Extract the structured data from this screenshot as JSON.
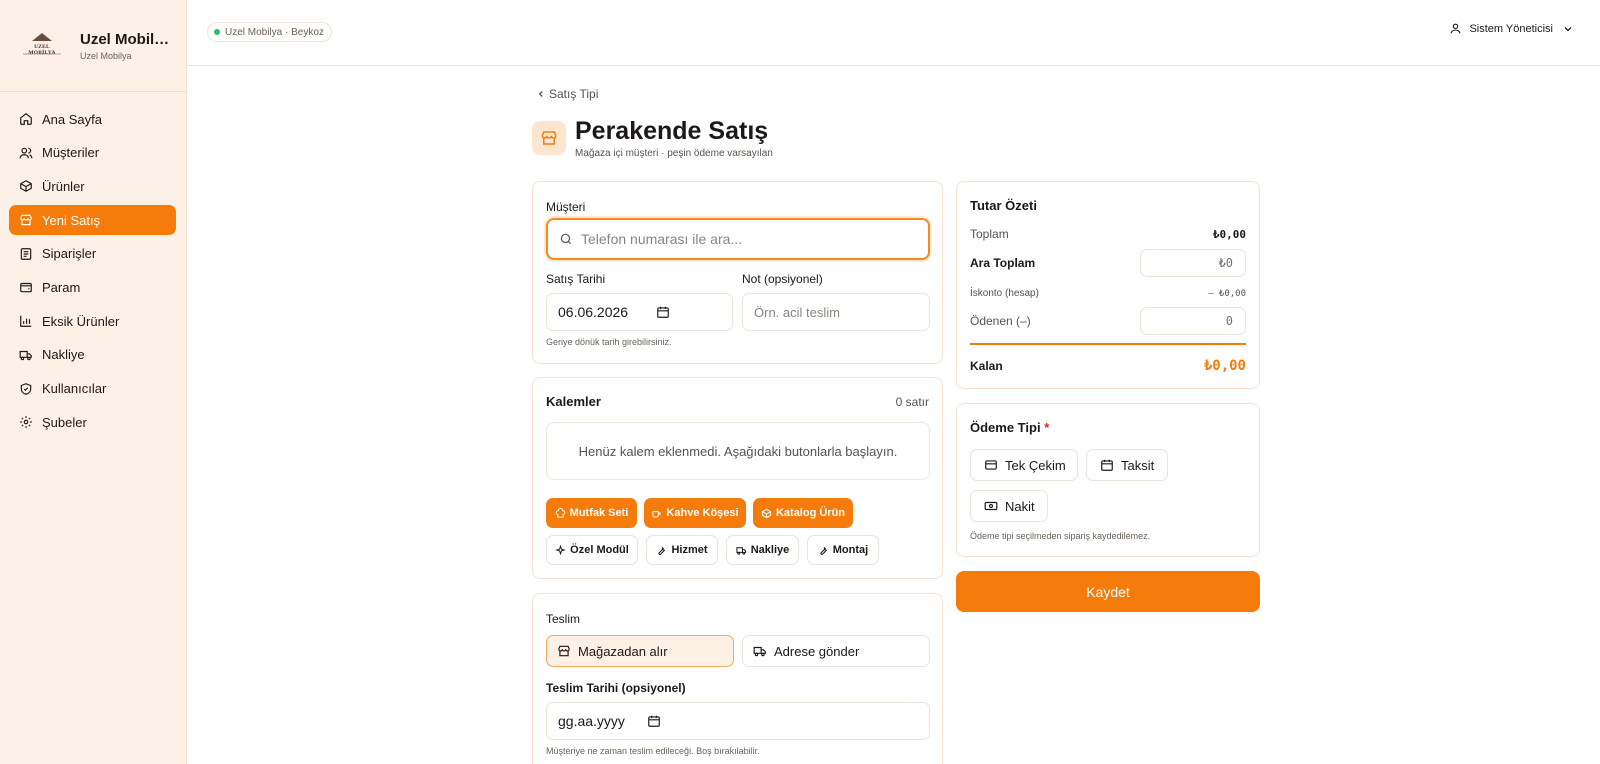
{
  "brand": {
    "title": "Uzel Mobilya",
    "subtitle": "Uzel Mobilya",
    "logo_text": "UZEL MOBİLYA",
    "logo_sub": "MOBİLYA & DEKORASYON"
  },
  "nav": [
    {
      "label": "Ana Sayfa",
      "icon": "home-icon"
    },
    {
      "label": "Müşteriler",
      "icon": "users-icon"
    },
    {
      "label": "Ürünler",
      "icon": "box-icon"
    },
    {
      "label": "Yeni Satış",
      "icon": "store-icon",
      "active": true
    },
    {
      "label": "Siparişler",
      "icon": "list-icon"
    },
    {
      "label": "Param",
      "icon": "wallet-icon"
    },
    {
      "label": "Eksik Ürünler",
      "icon": "bar-chart-icon"
    },
    {
      "label": "Nakliye",
      "icon": "truck-icon"
    },
    {
      "label": "Kullanıcılar",
      "icon": "shield-icon"
    },
    {
      "label": "Şubeler",
      "icon": "gear-icon"
    }
  ],
  "header": {
    "branch": "Uzel Mobilya · Beykoz",
    "user": "Sistem Yöneticisi"
  },
  "page": {
    "back": "Satış Tipi",
    "title": "Perakende Satış",
    "subtitle": "Mağaza içi müşteri · peşin ödeme varsayılan"
  },
  "customer": {
    "label": "Müşteri",
    "search_placeholder": "Telefon numarası ile ara...",
    "date_label": "Satış Tarihi",
    "date_value": "06.06.2026",
    "note_label": "Not (opsiyonel)",
    "note_placeholder": "Örn. acil teslim",
    "hint": "Geriye dönük tarih girebilirsiniz."
  },
  "items": {
    "title": "Kalemler",
    "count": "0 satır",
    "empty": "Henüz kalem eklenmedi. Aşağıdaki butonlarla başlayın.",
    "primary_buttons": [
      "Mutfak Seti",
      "Kahve Köşesi",
      "Katalog Ürün"
    ],
    "secondary_buttons": [
      "Özel Modül",
      "Hizmet",
      "Nakliye",
      "Montaj"
    ]
  },
  "delivery": {
    "title": "Teslim",
    "options": [
      "Mağazadan alır",
      "Adrese gönder"
    ],
    "selected": "Mağazadan alır",
    "date_label": "Teslim Tarihi (opsiyonel)",
    "date_placeholder": "gg.aa.yyyy",
    "hint": "Müşteriye ne zaman teslim edileceği. Boş bırakılabilir."
  },
  "summary": {
    "title": "Tutar Özeti",
    "total_label": "Toplam",
    "total_value": "₺0,00",
    "subtotal_label": "Ara Toplam",
    "subtotal_value": "₺0",
    "discount_label": "İskonto (hesap)",
    "discount_value": "– ₺0,00",
    "paid_label": "Ödenen (–)",
    "paid_value": "0",
    "remaining_label": "Kalan",
    "remaining_value": "₺0,00"
  },
  "payment": {
    "title": "Ödeme Tipi",
    "required_mark": "*",
    "options": [
      "Tek Çekim",
      "Taksit",
      "Nakit"
    ],
    "hint": "Ödeme tipi seçilmeden sipariş kaydedilemez."
  },
  "save_label": "Kaydet",
  "colors": {
    "accent": "#f57c0a",
    "sidebar_bg": "#fdf1e7",
    "online": "#22c55e"
  }
}
